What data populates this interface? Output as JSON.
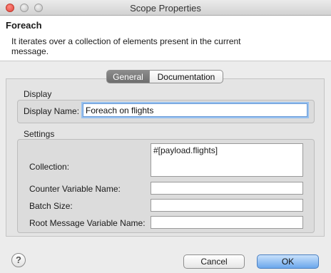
{
  "window": {
    "title": "Scope Properties"
  },
  "header": {
    "title": "Foreach",
    "description": "It iterates over a collection of elements present in the current message."
  },
  "tabs": [
    {
      "label": "General",
      "active": true
    },
    {
      "label": "Documentation",
      "active": false
    }
  ],
  "display": {
    "section_label": "Display",
    "display_name_label": "Display Name:",
    "display_name_value": "Foreach on flights"
  },
  "settings": {
    "section_label": "Settings",
    "collection_label": "Collection:",
    "collection_value": "#[payload.flights]",
    "counter_label": "Counter Variable Name:",
    "counter_value": "",
    "batch_label": "Batch Size:",
    "batch_value": "",
    "root_label": "Root Message Variable Name:",
    "root_value": ""
  },
  "footer": {
    "help_glyph": "?",
    "cancel_label": "Cancel",
    "ok_label": "OK"
  }
}
